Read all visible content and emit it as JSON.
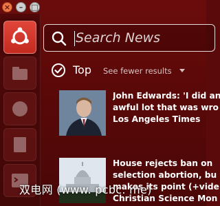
{
  "window_controls": {
    "close_glyph": "×",
    "minimize_glyph": "–",
    "maximize_glyph": "□"
  },
  "launcher": {
    "items": [
      {
        "icon": "ubuntu-logo-icon"
      },
      {
        "icon": "home-folder-icon"
      },
      {
        "icon": "browser-icon"
      },
      {
        "icon": "files-icon"
      },
      {
        "icon": "terminal-icon"
      }
    ]
  },
  "search": {
    "placeholder": "Search News",
    "value": ""
  },
  "category": {
    "title": "Top",
    "see_fewer": "See fewer results"
  },
  "results": [
    {
      "headline": "John Edwards: 'I did an\nawful lot that was wro\nLos Angeles Times",
      "thumbnail": "portrait-photo"
    },
    {
      "headline": "House rejects ban on\nselection abortion, bu\nmakes its point (+vide\nChristian Science Mon",
      "thumbnail": "capitol-photo"
    }
  ],
  "watermark": "双电网 (www. pcbc. me)",
  "colors": {
    "dash_background": "#5a0a0a",
    "launcher_bfb": "#d6382c",
    "close_button": "#f07746"
  }
}
